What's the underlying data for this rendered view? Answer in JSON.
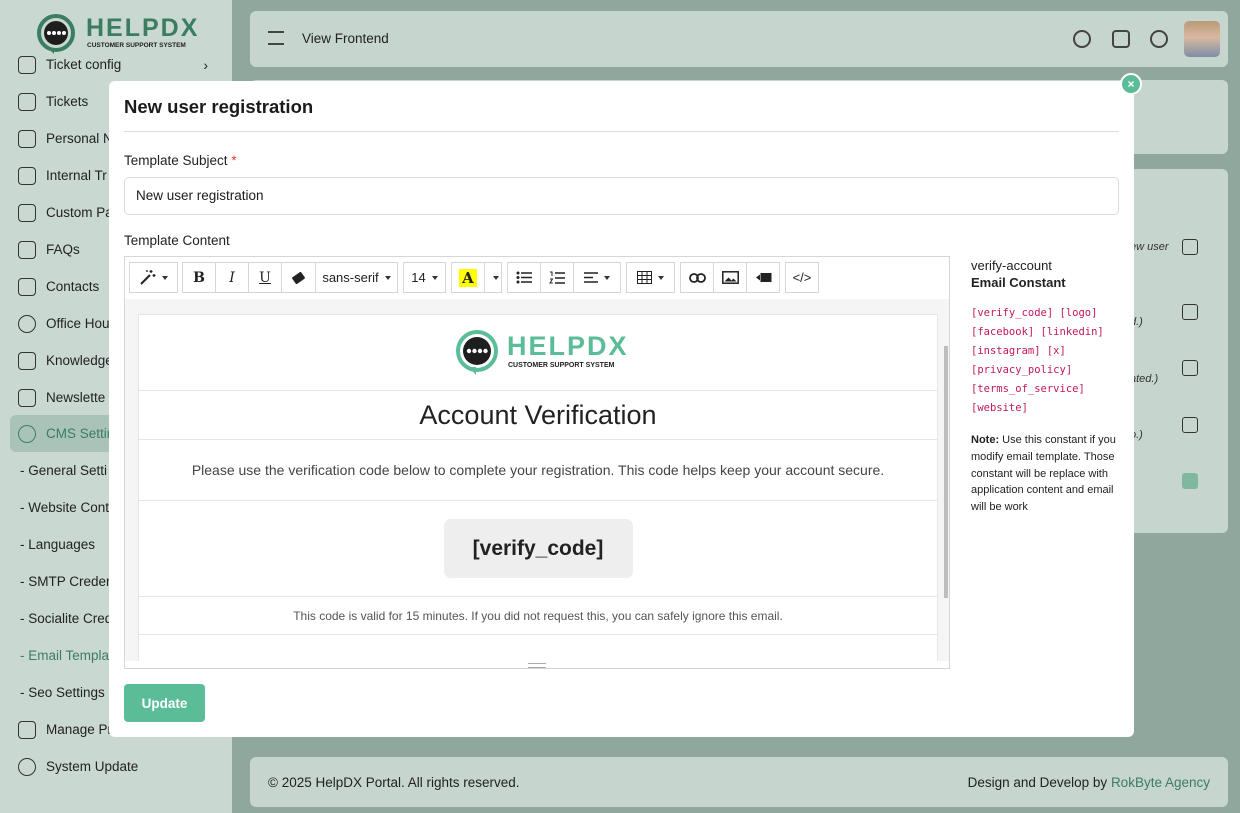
{
  "app": {
    "logo_text": "HELPDX",
    "logo_tagline": "CUSTOMER SUPPORT SYSTEM",
    "brand_color": "#5bbd97"
  },
  "sidebar": {
    "items": [
      {
        "label": "Ticket config",
        "icon": "gear-ticket-icon"
      },
      {
        "label": "Tickets",
        "icon": "ticket-icon"
      },
      {
        "label": "Personal N",
        "icon": "note-icon"
      },
      {
        "label": "Internal Tr",
        "icon": "layers-icon"
      },
      {
        "label": "Custom Pa",
        "icon": "page-icon"
      },
      {
        "label": "FAQs",
        "icon": "faq-icon"
      },
      {
        "label": "Contacts",
        "icon": "contacts-icon"
      },
      {
        "label": "Office Hou",
        "icon": "clock-icon"
      },
      {
        "label": "Knowledge",
        "icon": "knowledge-icon"
      },
      {
        "label": "Newslette",
        "icon": "newsletter-icon"
      },
      {
        "label": "CMS Settin",
        "icon": "gear-icon"
      }
    ],
    "subitems": [
      {
        "label": "- General Setti"
      },
      {
        "label": "- Website Cont"
      },
      {
        "label": "- Languages"
      },
      {
        "label": "- SMTP Creder"
      },
      {
        "label": "- Socialite Cred"
      },
      {
        "label": "- Email Templa"
      },
      {
        "label": "- Seo Settings"
      }
    ],
    "bottom_items": [
      {
        "label": "Manage Pr",
        "icon": "manage-icon"
      },
      {
        "label": "System Update",
        "icon": "update-icon"
      }
    ]
  },
  "topbar": {
    "view_frontend": "View Frontend"
  },
  "background_table": {
    "row_texts": [
      "ew user",
      "d.)",
      "ated.)",
      "o.)"
    ]
  },
  "footer": {
    "copyright": "© 2025 HelpDX Portal. All rights reserved.",
    "credit_prefix": "Design and Develop by ",
    "credit_link": "RokByte Agency"
  },
  "modal": {
    "title": "New user registration",
    "subject_label": "Template Subject",
    "required_mark": "*",
    "subject_value": "New user registration",
    "content_label": "Template Content",
    "toolbar": {
      "font_family": "sans-serif",
      "font_size": "14",
      "code_view": "</>"
    },
    "email": {
      "logo_text": "HELPDX",
      "logo_tagline": "CUSTOMER SUPPORT SYSTEM",
      "heading": "Account Verification",
      "intro": "Please use the verification code below to complete your registration. This code helps keep your account secure.",
      "code": "[verify_code]",
      "validity": "This code is valid for 15 minutes. If you did not request this, you can safely ignore this email."
    },
    "side": {
      "template_key": "verify-account",
      "heading": "Email Constant",
      "constants": [
        "[verify_code] [logo]",
        "[facebook] [linkedin]",
        "[instagram] [x]",
        "[privacy_policy]",
        "[terms_of_service]",
        "[website]"
      ],
      "note_label": "Note:",
      "note_text": " Use this constant if you modify email template. Those constant will be replace with application content and email will be work"
    },
    "update_label": "Update",
    "close_symbol": "×"
  }
}
